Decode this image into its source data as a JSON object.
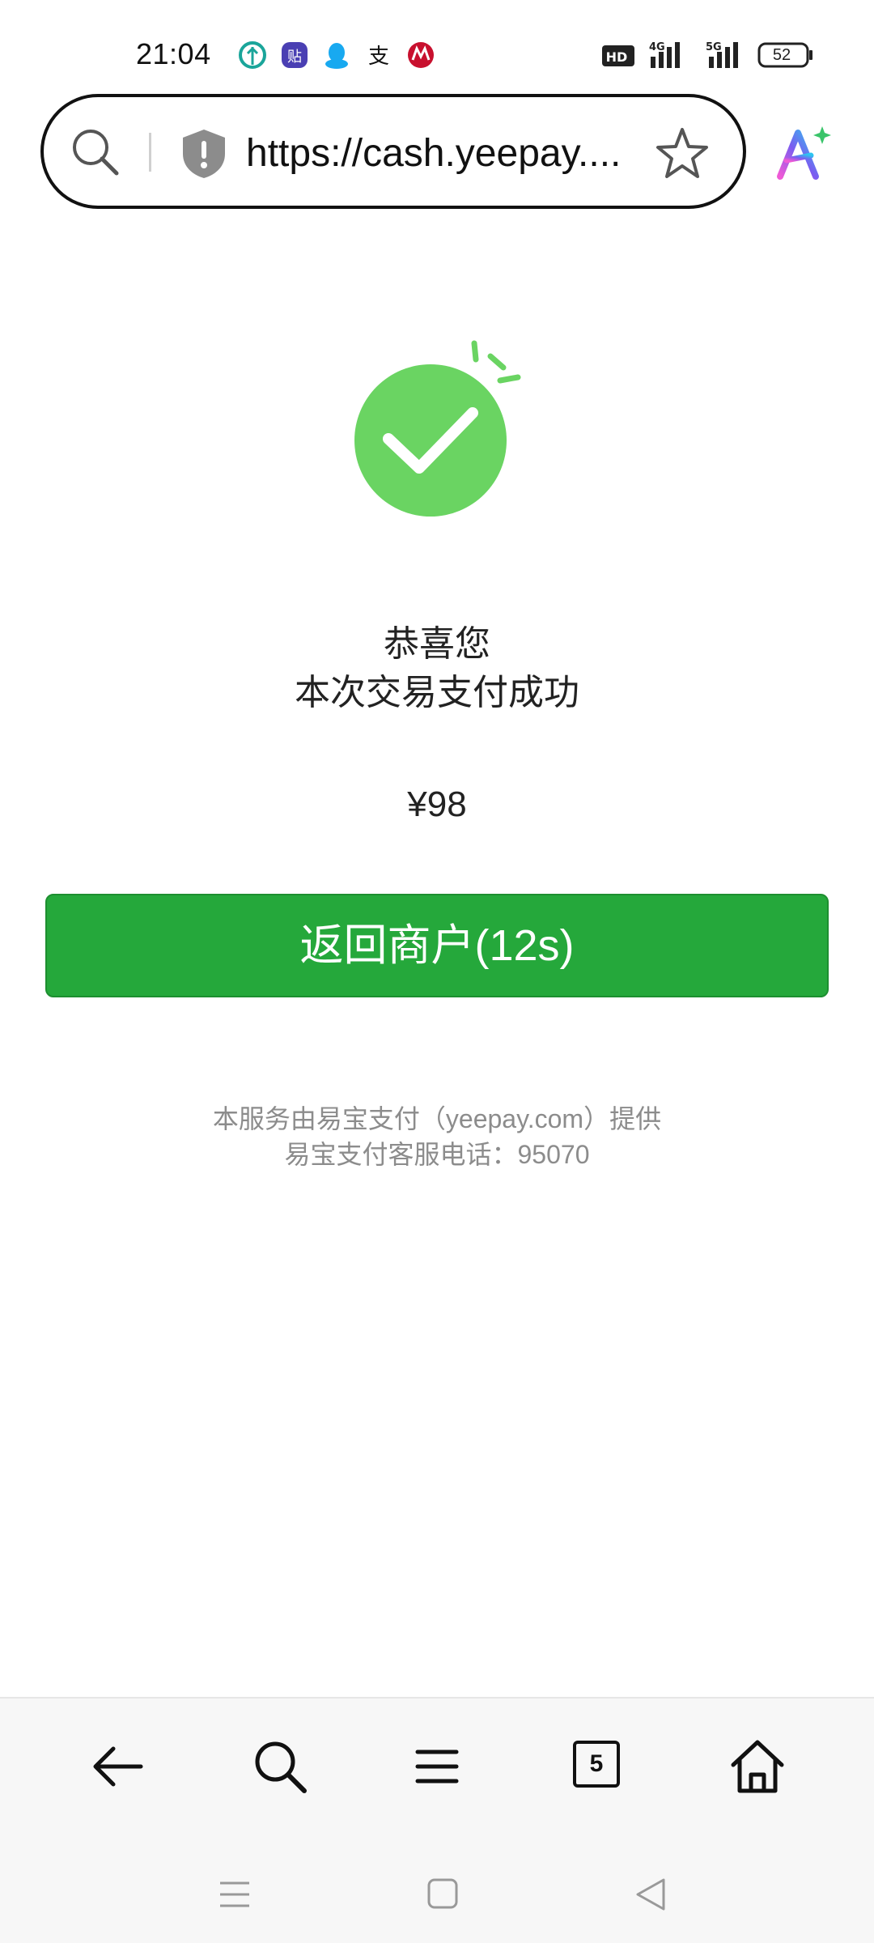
{
  "status_bar": {
    "time": "21:04",
    "notification_icons": [
      "eco-app-icon",
      "tie-app-icon",
      "qq-icon",
      "alipay-icon",
      "cmb-bank-icon"
    ],
    "network": [
      "hd-voice-icon",
      "4g-signal-icon",
      "5g-signal-icon"
    ],
    "battery_level": "52"
  },
  "browser": {
    "url": "https://cash.yeepay.com/cashier/...",
    "url_display": "https://cash.yeepay....",
    "security_icon": "shield-warning-icon",
    "tabs_count": "5",
    "accent_ai": "#7b5cf0"
  },
  "result": {
    "status_icon": "success-check-icon",
    "title": "恭喜您",
    "message": "本次交易支付成功",
    "amount": "¥98",
    "return_button_label": "返回商户(12s)",
    "footer_line1": "本服务由易宝支付（yeepay.com）提供",
    "footer_line2": "易宝支付客服电话：95070"
  },
  "toolbar": {
    "items": [
      "back-icon",
      "search-icon",
      "menu-icon",
      "tabs-icon",
      "home-icon"
    ]
  },
  "system_nav": [
    "recents-icon",
    "home-square-icon",
    "back-triangle-icon"
  ],
  "colors": {
    "success_green": "#6ad462",
    "button_green": "#25a83b",
    "footer_gray": "#8c8c8c"
  }
}
